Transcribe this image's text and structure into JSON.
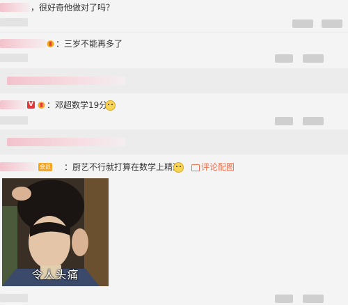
{
  "comments": [
    {
      "text": "，很好奇他做对了吗？"
    },
    {
      "text": "：三岁不能再多了"
    },
    {
      "vip_letter": "V",
      "text": "：邓超数学19分"
    },
    {
      "level_badge": "会员",
      "text": "：厨艺不行就打算在数学上精进",
      "link_label": "评论配图"
    }
  ],
  "image": {
    "caption": "令人头痛",
    "icon": "photo-of-woman-holding-head"
  },
  "colors": {
    "accent": "#eb7350",
    "vip": "#e4393c",
    "background": "#f4f4f4"
  }
}
